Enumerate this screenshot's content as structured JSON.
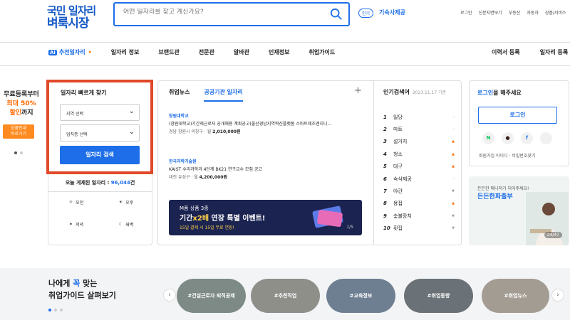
{
  "logo": {
    "line1": "국민 일자리",
    "line2": "벼룩시장"
  },
  "search": {
    "placeholder": "어떤 일자리를 찾고 계신가요?"
  },
  "header_badge": "인기",
  "header_link": "기숙사제공",
  "top_links": [
    "로그인",
    "신문지면보기",
    "부동산",
    "자동차",
    "상품/서비스"
  ],
  "nav": {
    "ai_badge": "Ai",
    "items": [
      "추천일자리",
      "일자리 정보",
      "브랜드관",
      "전문관",
      "알바관",
      "인재정보",
      "취업가이드"
    ],
    "right": [
      "이력서 등록",
      "일자리 등록"
    ]
  },
  "promo": {
    "line1": "무료등록부터",
    "line2": "최대 50%",
    "line3": "할인",
    "line3b": "까지",
    "button": "상품안내\n바로가기"
  },
  "quick": {
    "title": "일자리 빠르게 찾기",
    "region": "지역 선택",
    "job": "업직종 선택",
    "button": "일자리 검색",
    "count_label": "오늘 게재된 일자리 : ",
    "count": "96,044",
    "count_unit": "건",
    "times": [
      "오전",
      "오후",
      "저녁",
      "새벽"
    ]
  },
  "news": {
    "tabs": [
      "취업뉴스",
      "공공기관 일자리"
    ],
    "items": [
      {
        "org": "창원대학교",
        "title": "(창원대학교)기간제근로자 공개채용 계획공고(울산경남지역혁신플랫폼 스마트제조엔지니...",
        "meta": "경남 창원시 의창구 · 월",
        "pay": "2,010,000원"
      },
      {
        "org": "한국과학기술원",
        "title": "KAIST 수리과학과 4단계 BK21 연구교수 모집 공고",
        "meta": "대전 유성구 · 월",
        "pay": "4,200,000원"
      }
    ],
    "banner": {
      "t1": "M폼 상품 3종",
      "t2a": "기간",
      "t2b": "x2배",
      "t2c": " 연장 특별 이벤트!",
      "t3": "15일 결제 시 15일 무료 연장!",
      "page": "1/5"
    }
  },
  "popular": {
    "title": "인기검색어",
    "date": "2023.11.17 기준",
    "items": [
      {
        "rank": "1",
        "kw": "일당",
        "trend": "–",
        "dir": "nc"
      },
      {
        "rank": "2",
        "kw": "마트",
        "trend": "–",
        "dir": "nc"
      },
      {
        "rank": "3",
        "kw": "설거지",
        "trend": "▲",
        "dir": "up"
      },
      {
        "rank": "4",
        "kw": "청소",
        "trend": "▲",
        "dir": "up"
      },
      {
        "rank": "5",
        "kw": "대구",
        "trend": "▲",
        "dir": "up"
      },
      {
        "rank": "6",
        "kw": "숙식제공",
        "trend": "–",
        "dir": "nc"
      },
      {
        "rank": "7",
        "kw": "야간",
        "trend": "▼",
        "dir": "dn"
      },
      {
        "rank": "8",
        "kw": "용접",
        "trend": "▲",
        "dir": "up"
      },
      {
        "rank": "9",
        "kw": "숯불장치",
        "trend": "▼",
        "dir": "dn"
      },
      {
        "rank": "10",
        "kw": "횟집",
        "trend": "▼",
        "dir": "dn"
      }
    ]
  },
  "login": {
    "title_a": "로그인",
    "title_b": "을 해주세요",
    "button": "로그인",
    "social": [
      "N",
      "●",
      "f",
      ""
    ],
    "links": "회원가입  아이디 · 비밀번호찾기"
  },
  "ad": {
    "line1": "든든한 매니저가 되어주세요!",
    "line2": "든든한파출부",
    "page": "24/47"
  },
  "bottom": {
    "title_a": "나에게 ",
    "title_b": "꼭",
    "title_c": " 맞는",
    "title2": "취업가이드 살펴보기",
    "pills": [
      "#건설근로자 퇴직공제",
      "#추천직업",
      "#교육정보",
      "#취업동향",
      "#취업뉴스"
    ],
    "prev": "‹",
    "next": "›"
  }
}
